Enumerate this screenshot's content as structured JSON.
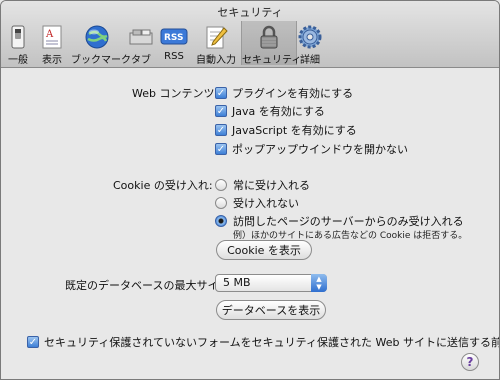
{
  "window": {
    "title": "セキュリティ"
  },
  "toolbar": {
    "items": [
      {
        "label": "一般",
        "icon": "switch-icon"
      },
      {
        "label": "表示",
        "icon": "font-icon"
      },
      {
        "label": "ブックマーク",
        "icon": "globe-icon"
      },
      {
        "label": "タブ",
        "icon": "tabs-icon"
      },
      {
        "label": "RSS",
        "icon": "rss-icon"
      },
      {
        "label": "自動入力",
        "icon": "pencil-icon"
      },
      {
        "label": "セキュリティ",
        "icon": "lock-icon",
        "selected": true
      },
      {
        "label": "詳細",
        "icon": "gear-icon"
      }
    ]
  },
  "web_content": {
    "label": "Web コンテンツ:",
    "options": [
      {
        "label": "プラグインを有効にする",
        "checked": true
      },
      {
        "label": "Java を有効にする",
        "checked": true
      },
      {
        "label": "JavaScript を有効にする",
        "checked": true
      },
      {
        "label": "ポップアップウインドウを開かない",
        "checked": true
      }
    ]
  },
  "cookie": {
    "label": "Cookie の受け入れ:",
    "options": [
      {
        "label": "常に受け入れる",
        "selected": false
      },
      {
        "label": "受け入れない",
        "selected": false
      },
      {
        "label": "訪問したページのサーバーからのみ受け入れる",
        "selected": true
      }
    ],
    "note": "例）ほかのサイトにある広告などの Cookie は拒否する。",
    "show_button": "Cookie を表示"
  },
  "database": {
    "label": "既定のデータベースの最大サイ",
    "size_value": "5 MB",
    "show_button": "データベースを表示"
  },
  "secure_form": {
    "label": "セキュリティ保護されていないフォームをセキュリティ保護された Web サイトに送信する前に確認",
    "checked": true
  },
  "help": {
    "symbol": "?"
  }
}
